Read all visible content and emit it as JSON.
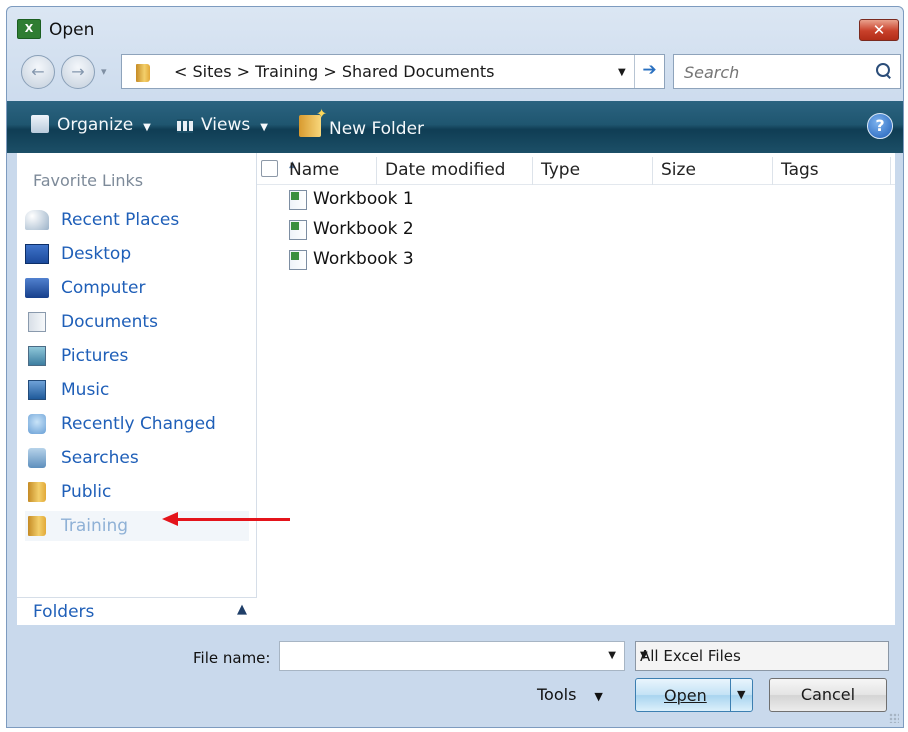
{
  "window": {
    "title": "Open",
    "close_glyph": "✕"
  },
  "nav": {
    "back_glyph": "←",
    "forward_glyph": "→",
    "history_glyph": "▾"
  },
  "address": {
    "path": "< Sites > Training > Shared Documents",
    "go_glyph": "➔"
  },
  "search": {
    "placeholder": "Search"
  },
  "toolbar": {
    "organize_label": "Organize",
    "views_label": "Views",
    "new_folder_label": "New Folder",
    "caret": "▼",
    "help_glyph": "?"
  },
  "favorites": {
    "header": "Favorite Links",
    "items": [
      {
        "label": "Recent Places",
        "icon": "recent-places-icon"
      },
      {
        "label": "Desktop",
        "icon": "desktop-icon"
      },
      {
        "label": "Computer",
        "icon": "computer-icon"
      },
      {
        "label": "Documents",
        "icon": "documents-icon"
      },
      {
        "label": "Pictures",
        "icon": "pictures-icon"
      },
      {
        "label": "Music",
        "icon": "music-icon"
      },
      {
        "label": "Recently Changed",
        "icon": "recently-changed-icon"
      },
      {
        "label": "Searches",
        "icon": "searches-icon"
      },
      {
        "label": "Public",
        "icon": "folder-icon"
      },
      {
        "label": "Training",
        "icon": "folder-icon"
      }
    ]
  },
  "folders": {
    "label": "Folders",
    "chevron": "▲"
  },
  "columns": [
    "Name",
    "Date modified",
    "Type",
    "Size",
    "Tags"
  ],
  "files": [
    "Workbook 1",
    "Workbook 2",
    "Workbook 3"
  ],
  "footer": {
    "file_name_label": "File name:",
    "file_name_value": "",
    "filter_value": "All Excel Files",
    "tools_label": "Tools",
    "open_label": "Open",
    "cancel_label": "Cancel",
    "drop_glyph": "▼"
  },
  "colors": {
    "annotation_arrow": "#e4141b",
    "link_blue": "#1f5fb8",
    "toolbar": "#1f5670"
  }
}
